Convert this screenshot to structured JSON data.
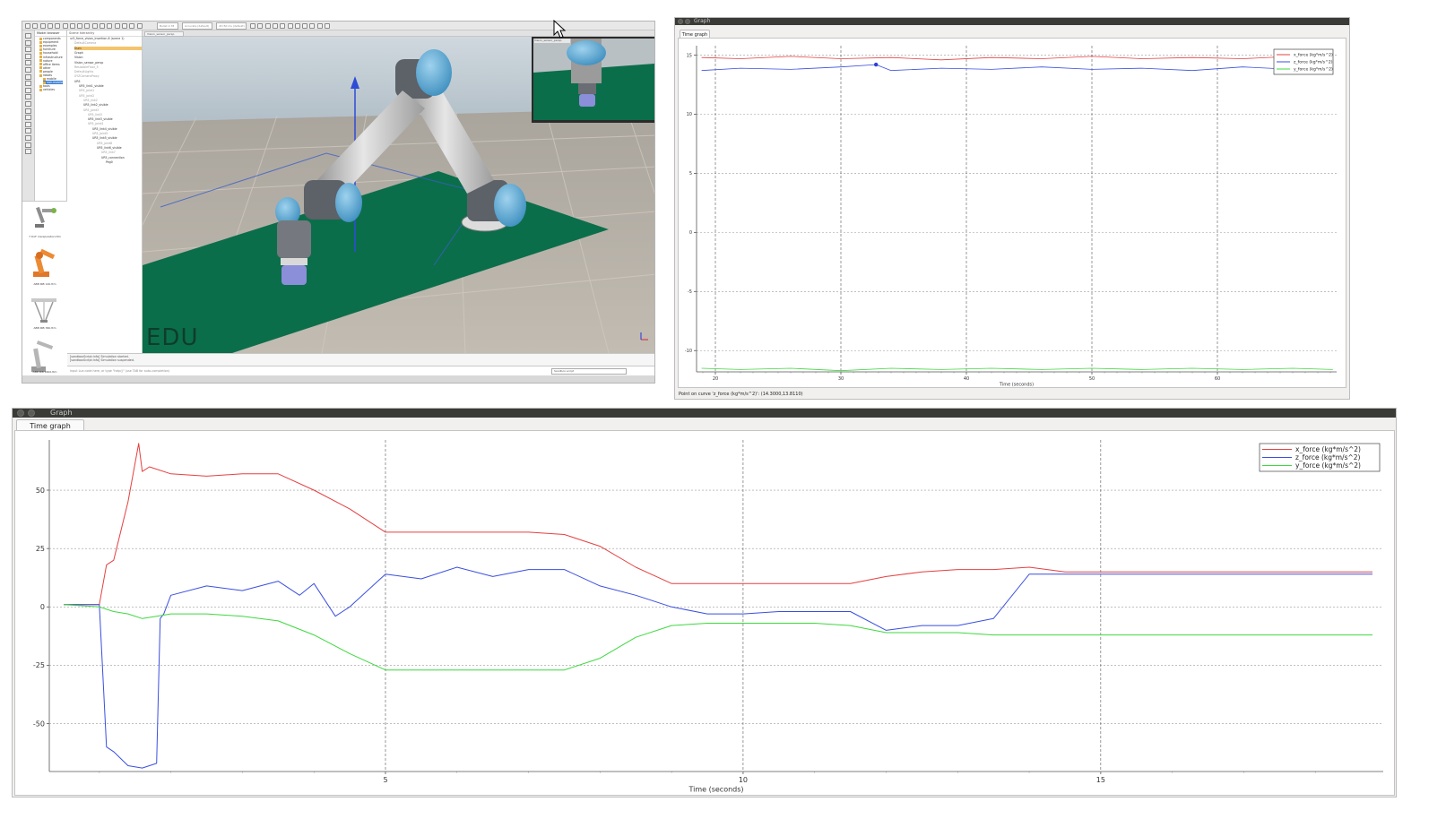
{
  "simulator": {
    "toolbar": {
      "combo_engine": "Bullet 2.78",
      "combo_accuracy": "Accurate (default)",
      "combo_dt": "dt=50 ms (default)"
    },
    "model_browser": {
      "title": "Model browser",
      "items": [
        "components",
        "equipment",
        "examples",
        "furniture",
        "household",
        "infrastructure",
        "nature",
        "office items",
        "other",
        "people",
        "robots",
        "mobile",
        "non-mobile",
        "tools",
        "vehicles"
      ],
      "selected_index": 12,
      "thumbnails": [
        "7 DoF manipulation.ttm",
        "ABB IRB 140.ttm",
        "ABB IRB 360.ttm",
        "ABB IRB 1600.ttm"
      ]
    },
    "scene_hierarchy": {
      "title": "Scene hierarchy",
      "items": [
        {
          "label": "ur5_force_vision_insertion-6 (scene 1)",
          "indent": 0,
          "dim": false
        },
        {
          "label": "DefaultCamera",
          "indent": 1,
          "dim": true
        },
        {
          "label": "Dum",
          "indent": 1,
          "dim": false,
          "sel": true
        },
        {
          "label": "Graph",
          "indent": 1,
          "dim": false
        },
        {
          "label": "Vision",
          "indent": 1,
          "dim": false
        },
        {
          "label": "Vision_sensor_persp",
          "indent": 1,
          "dim": false
        },
        {
          "label": "ResizableFloor_5",
          "indent": 1,
          "dim": true
        },
        {
          "label": "DefaultLights",
          "indent": 1,
          "dim": true
        },
        {
          "label": "XYZCameraProxy",
          "indent": 1,
          "dim": true
        },
        {
          "label": "UR5",
          "indent": 1,
          "dim": false
        },
        {
          "label": "UR5_link1_visible",
          "indent": 2,
          "dim": false
        },
        {
          "label": "UR5_joint1",
          "indent": 2,
          "dim": true
        },
        {
          "label": "UR5_joint2",
          "indent": 2,
          "dim": true
        },
        {
          "label": "UR5_link2",
          "indent": 3,
          "dim": true
        },
        {
          "label": "UR5_link2_visible",
          "indent": 3,
          "dim": false
        },
        {
          "label": "UR5_joint3",
          "indent": 3,
          "dim": true
        },
        {
          "label": "UR5_link3",
          "indent": 4,
          "dim": true
        },
        {
          "label": "UR5_link3_visible",
          "indent": 4,
          "dim": false
        },
        {
          "label": "UR5_joint4",
          "indent": 4,
          "dim": true
        },
        {
          "label": "UR5_link4_visible",
          "indent": 5,
          "dim": false
        },
        {
          "label": "UR5_joint5",
          "indent": 5,
          "dim": true
        },
        {
          "label": "UR5_link5_visible",
          "indent": 5,
          "dim": false
        },
        {
          "label": "UR5_joint6",
          "indent": 6,
          "dim": true
        },
        {
          "label": "UR5_link6_visible",
          "indent": 6,
          "dim": false
        },
        {
          "label": "UR5_link7",
          "indent": 7,
          "dim": true
        },
        {
          "label": "UR5_connection",
          "indent": 7,
          "dim": false
        },
        {
          "label": "Peg0",
          "indent": 8,
          "dim": false
        }
      ]
    },
    "view_tab": "Vision_sensor_persp",
    "float_view_title": "Vision_sensor_persp",
    "edu_label": "EDU",
    "status_lines": [
      "[sandboxScript:info]     Simulation started.",
      "[sandboxScript:info]     Simulation suspended."
    ],
    "cmd_placeholder": "Input Lua code here, or type \"help()\" (use TAB for auto-completion)",
    "cmd_combo": "Sandbox script"
  },
  "graph_small": {
    "title": "Graph",
    "tab": "Time graph",
    "status": "Point on curve 'z_force (kg*m/s^2)': (14.3000,13.8110)",
    "colors": {
      "x": "#e54040",
      "z": "#3a4fe0",
      "y": "#3fd83f"
    },
    "chart_data": {
      "type": "line",
      "xlabel": "Time (seconds)",
      "ylabel": "",
      "xlim": [
        18.5,
        69.5
      ],
      "ylim": [
        -11.8,
        15.8
      ],
      "xticks": [
        20,
        30,
        40,
        50,
        60
      ],
      "yticks": [
        -10,
        -5,
        0,
        5,
        10,
        15
      ],
      "legend_position": "top-right",
      "grid": true,
      "series": [
        {
          "name": "x_force (kg*m/s^2)",
          "color": "#e54040",
          "x": [
            18.9,
            22,
            26,
            30,
            34,
            38,
            42,
            46,
            50,
            54,
            58,
            62,
            66,
            69.2
          ],
          "y": [
            14.8,
            14.7,
            14.9,
            14.7,
            14.8,
            14.6,
            14.8,
            14.7,
            14.9,
            14.7,
            14.8,
            14.7,
            14.9,
            14.8
          ]
        },
        {
          "name": "z_force (kg*m/s^2)",
          "color": "#3a4fe0",
          "x": [
            18.9,
            22,
            26,
            30,
            32.8,
            34,
            38,
            42,
            46,
            50,
            54,
            58,
            62,
            66,
            69.2
          ],
          "y": [
            13.7,
            13.9,
            13.8,
            14.0,
            14.2,
            13.7,
            13.9,
            13.8,
            14.0,
            13.8,
            13.9,
            13.7,
            14.0,
            13.8,
            13.9
          ]
        },
        {
          "name": "y_force (kg*m/s^2)",
          "color": "#3fd83f",
          "x": [
            18.9,
            22,
            26,
            30,
            34,
            38,
            42,
            46,
            50,
            54,
            58,
            62,
            66,
            69.2
          ],
          "y": [
            -11.5,
            -11.6,
            -11.5,
            -11.7,
            -11.5,
            -11.6,
            -11.5,
            -11.6,
            -11.5,
            -11.6,
            -11.5,
            -11.6,
            -11.5,
            -11.6
          ]
        }
      ],
      "highlight_point": {
        "series": "z_force (kg*m/s^2)",
        "x": 32.8,
        "y": 14.2
      }
    }
  },
  "graph_large": {
    "title": "Graph",
    "tab": "Time graph",
    "colors": {
      "x": "#e54040",
      "z": "#3a4fe0",
      "y": "#3fd83f"
    },
    "chart_data": {
      "type": "line",
      "xlabel": "Time (seconds)",
      "ylabel": "",
      "xlim": [
        0.3,
        18.95
      ],
      "ylim": [
        -70.5,
        71.5
      ],
      "xticks": [
        5,
        10,
        15
      ],
      "yticks": [
        -50,
        -25,
        0,
        25,
        50
      ],
      "legend_position": "top-right",
      "grid": true,
      "series": [
        {
          "name": "x_force (kg*m/s^2)",
          "color": "#e54040",
          "x": [
            0.5,
            1.0,
            1.1,
            1.2,
            1.4,
            1.55,
            1.6,
            1.7,
            2.0,
            2.5,
            3.0,
            3.5,
            4.0,
            4.5,
            5.0,
            5.5,
            6.0,
            6.5,
            7.0,
            7.5,
            8.0,
            8.5,
            9.0,
            9.5,
            10.0,
            10.5,
            11.0,
            11.5,
            12.0,
            12.5,
            13.0,
            13.5,
            14.0,
            14.5,
            15.0,
            16.0,
            17.0,
            18.0,
            18.8
          ],
          "y": [
            1,
            1,
            18,
            20,
            45,
            70,
            58,
            60,
            57,
            56,
            57,
            57,
            50,
            42,
            32,
            32,
            32,
            32,
            32,
            31,
            26,
            17,
            10,
            10,
            10,
            10,
            10,
            10,
            13,
            15,
            16,
            16,
            17,
            15,
            15,
            15,
            15,
            15,
            15
          ]
        },
        {
          "name": "z_force (kg*m/s^2)",
          "color": "#3a4fe0",
          "x": [
            0.5,
            1.0,
            1.1,
            1.2,
            1.4,
            1.6,
            1.8,
            1.85,
            1.9,
            2.0,
            2.5,
            3.0,
            3.5,
            3.8,
            4.0,
            4.3,
            4.5,
            5.0,
            5.5,
            6.0,
            6.5,
            7.0,
            7.5,
            8.0,
            8.5,
            9.0,
            9.5,
            10.0,
            10.5,
            11.0,
            11.5,
            12.0,
            12.5,
            13.0,
            13.5,
            14.0,
            14.5,
            15.0,
            16.0,
            17.0,
            18.0,
            18.8
          ],
          "y": [
            1,
            1,
            -60,
            -62,
            -68,
            -69,
            -67,
            -5,
            -3,
            5,
            9,
            7,
            11,
            5,
            10,
            -4,
            0,
            14,
            12,
            17,
            13,
            16,
            16,
            9,
            5,
            0,
            -3,
            -3,
            -2,
            -2,
            -2,
            -10,
            -8,
            -8,
            -5,
            14,
            14,
            14,
            14,
            14,
            14,
            14
          ]
        },
        {
          "name": "y_force (kg*m/s^2)",
          "color": "#3fd83f",
          "x": [
            0.5,
            1.0,
            1.2,
            1.4,
            1.6,
            1.8,
            2.0,
            2.5,
            3.0,
            3.5,
            4.0,
            4.5,
            5.0,
            5.5,
            6.0,
            6.5,
            7.0,
            7.5,
            8.0,
            8.5,
            9.0,
            9.5,
            10.0,
            10.5,
            11.0,
            11.5,
            12.0,
            12.5,
            13.0,
            13.5,
            14.0,
            15.0,
            16.0,
            17.0,
            18.0,
            18.8
          ],
          "y": [
            1,
            0,
            -2,
            -3,
            -5,
            -4,
            -3,
            -3,
            -4,
            -6,
            -12,
            -20,
            -27,
            -27,
            -27,
            -27,
            -27,
            -27,
            -22,
            -13,
            -8,
            -7,
            -7,
            -7,
            -7,
            -8,
            -11,
            -11,
            -11,
            -12,
            -12,
            -12,
            -12,
            -12,
            -12,
            -12
          ]
        }
      ]
    }
  }
}
